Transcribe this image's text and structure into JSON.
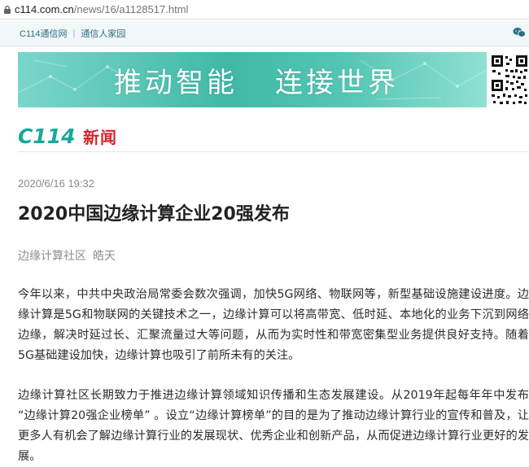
{
  "browser": {
    "url_host": "c114.com.cn",
    "url_path": "/news/16/a1128517.html"
  },
  "site_nav": {
    "link_home": "C114通信网",
    "separator": "|",
    "link_community": "通信人家园"
  },
  "banner": {
    "slogan_left": "推动智能",
    "slogan_right": "连接世界"
  },
  "logo": {
    "mark_text": "C114",
    "section": "新闻"
  },
  "article": {
    "date": "2020/6/16 19:32",
    "title": "2020中国边缘计算企业20强发布",
    "source": "边缘计算社区",
    "author": "皓天",
    "paragraphs": [
      "今年以来，中共中央政治局常委会数次强调，加快5G网络、物联网等，新型基础设施建设进度。边缘计算是5G和物联网的关键技术之一，边缘计算可以将高带宽、低时延、本地化的业务下沉到网络边缘，解决时延过长、汇聚流量过大等问题，从而为实时性和带宽密集型业务提供良好支持。随着5G基础建设加快，边缘计算也吸引了前所未有的关注。",
      "边缘计算社区长期致力于推进边缘计算领域知识传播和生态发展建设。从2019年起每年年中发布 “边缘计算20强企业榜单” 。设立“边缘计算榜单”的目的是为了推动边缘计算行业的宣传和普及，让更多人有机会了解边缘计算行业的发展现状、优秀企业和创新产品，从而促进边缘计算行业更好的发展。"
    ]
  },
  "colors": {
    "brand_red": "#d5262b",
    "banner_teal": "#3fb9a6",
    "nav_link": "#2a6f87",
    "logo_teal": "#1aa89a"
  },
  "icons": [
    "lock-icon",
    "wechat-icon",
    "qr-code"
  ]
}
